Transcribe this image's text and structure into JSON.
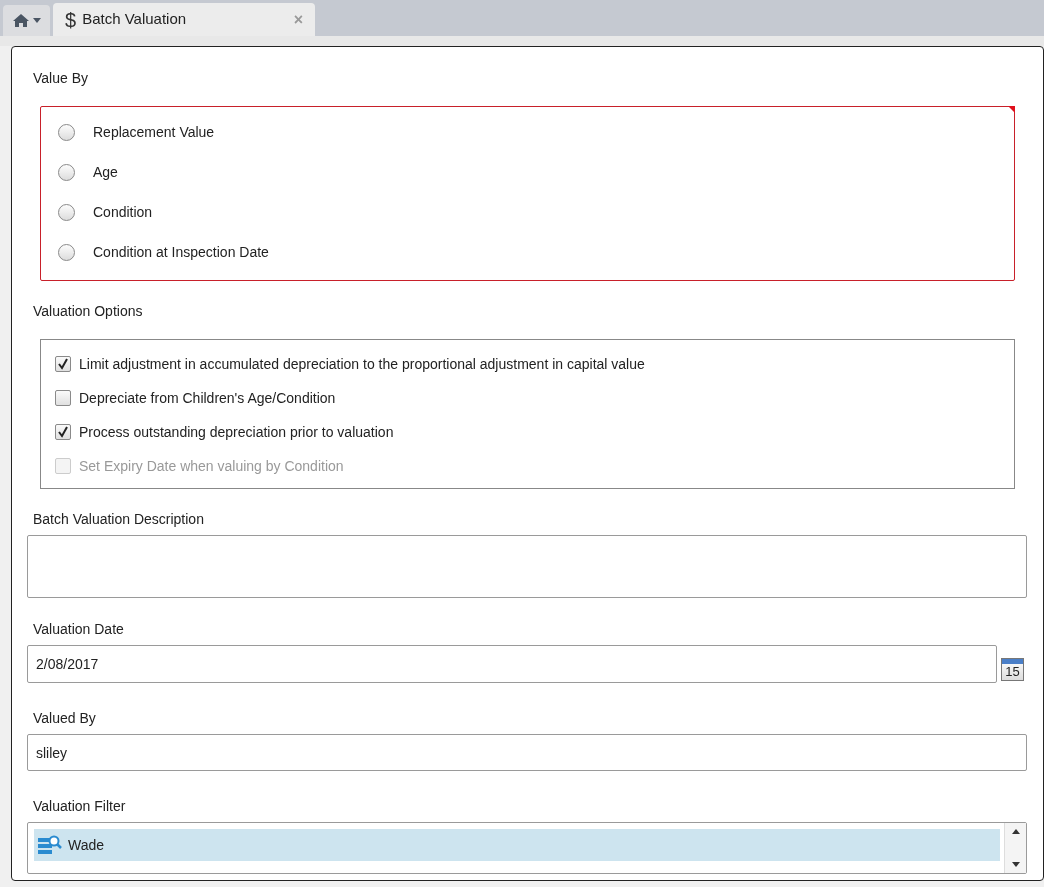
{
  "tabs": [
    {
      "kind": "home",
      "selected": false
    },
    {
      "kind": "page",
      "symbol": "$",
      "label": "Batch Valuation",
      "close": "×",
      "selected": true
    }
  ],
  "value_by": {
    "label": "Value By",
    "invalid": true,
    "options": [
      {
        "label": "Replacement Value",
        "selected": false
      },
      {
        "label": "Age",
        "selected": false
      },
      {
        "label": "Condition",
        "selected": false
      },
      {
        "label": "Condition at Inspection Date",
        "selected": false
      }
    ]
  },
  "valuation_options": {
    "label": "Valuation Options",
    "options": [
      {
        "label": "Limit adjustment in accumulated depreciation to the proportional adjustment in capital value",
        "checked": true,
        "disabled": false
      },
      {
        "label": "Depreciate from Children's Age/Condition",
        "checked": false,
        "disabled": false
      },
      {
        "label": "Process outstanding depreciation prior to valuation",
        "checked": true,
        "disabled": false
      },
      {
        "label": "Set Expiry Date when valuing by Condition",
        "checked": false,
        "disabled": true
      }
    ]
  },
  "description": {
    "label": "Batch Valuation Description"
  },
  "valuation_date": {
    "label": "Valuation Date",
    "value": "2/08/2017",
    "calendar_day": "15"
  },
  "valued_by": {
    "label": "Valued By",
    "value": "sliley"
  },
  "valuation_filter": {
    "label": "Valuation Filter",
    "items": [
      {
        "label": "Wade",
        "selected": true
      }
    ]
  }
}
